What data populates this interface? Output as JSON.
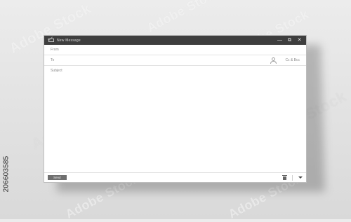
{
  "window": {
    "title": "New Message",
    "buttons": {
      "minimize": "—",
      "restore": "⧉",
      "close": "✕"
    }
  },
  "fields": {
    "from_label": "From",
    "to_label": "To",
    "cc_bcc_label": "Cc & Bcc",
    "subject_label": "Subject"
  },
  "footer": {
    "send_label": "Send"
  },
  "watermark": {
    "text": "Adobe Stock",
    "id": "206603585"
  },
  "icons": {
    "title": "mail-icon",
    "minimize": "minimize-icon",
    "restore": "restore-icon",
    "close": "close-icon",
    "recipients": "person-icon",
    "delete": "trash-icon",
    "more": "chevron-down-icon"
  },
  "colors": {
    "titlebar": "#3e3e3e",
    "send_button": "#6f6f6f",
    "background": "#e0e0e0"
  }
}
